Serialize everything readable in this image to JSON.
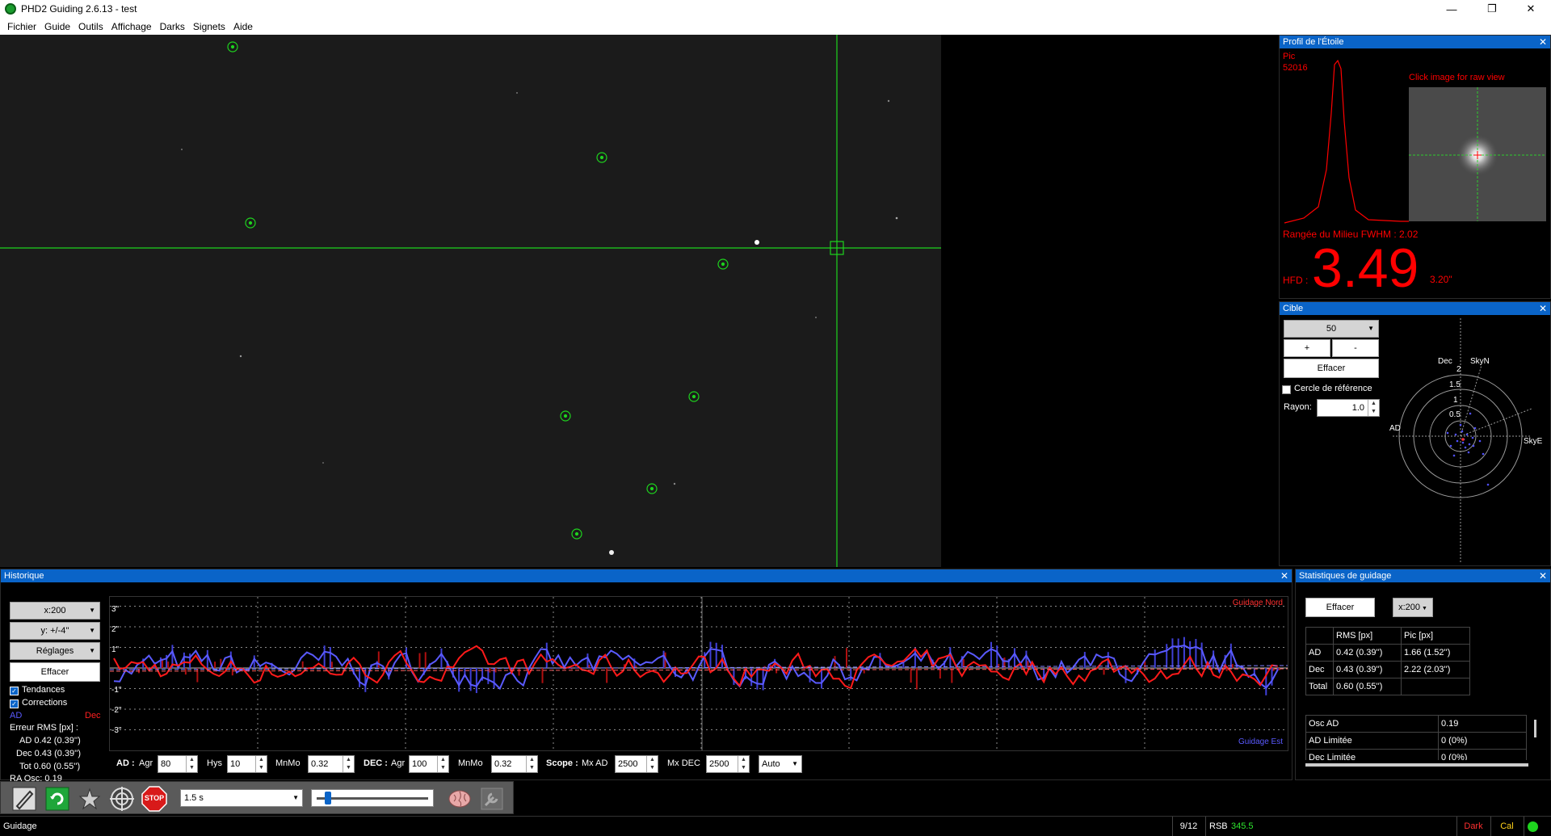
{
  "window": {
    "title": "PHD2 Guiding 2.6.13 - test",
    "minimize": "—",
    "maximize": "❐",
    "close": "✕"
  },
  "menu": [
    "Fichier",
    "Guide",
    "Outils",
    "Affichage",
    "Darks",
    "Signets",
    "Aide"
  ],
  "profile": {
    "title": "Profil de l'Étoile",
    "peak_label": "Pic",
    "peak_value": "52016",
    "click_hint": "Click image for raw view",
    "fwhm_label": "Rangée du Milieu FWHM : 2.02",
    "hfd_label": "HFD :",
    "hfd_value": "3.49",
    "hfd_arcsec": "3.20\""
  },
  "target": {
    "title": "Cible",
    "zoom": "50",
    "plus": "+",
    "minus": "-",
    "clear": "Effacer",
    "ref_circle": "Cercle de référence",
    "radius_label": "Rayon:",
    "radius_value": "1.0",
    "dec_label": "Dec",
    "skyn_label": "SkyN",
    "ad_label": "AD",
    "skye_label": "SkyE",
    "rings": [
      "2",
      "1.5",
      "1",
      "0.5"
    ]
  },
  "history": {
    "title": "Historique",
    "x_scale": "x:200",
    "y_scale": "y: +/-4''",
    "settings": "Réglages",
    "clear": "Effacer",
    "trends": "Tendances",
    "corrections": "Corrections",
    "ad_legend": "AD",
    "dec_legend": "Dec",
    "rms_title": "Erreur RMS [px] :",
    "rms_ad": "AD  0.42 (0.39'')",
    "rms_dec": "Dec  0.43 (0.39'')",
    "rms_tot": "Tot  0.60 (0.55'')",
    "ra_osc": "RA Osc: 0.19",
    "guide_north": "Guidage Nord",
    "guide_east": "Guidage Est",
    "y_ticks": [
      "3\"",
      "2\"",
      "1\"",
      "-1\"",
      "-2\"",
      "-3\""
    ],
    "ad_group": "AD :",
    "agr_label": "Agr",
    "ad_agr": "80",
    "hys_label": "Hys",
    "ad_hys": "10",
    "mnmo_label": "MnMo",
    "ad_mnmo": "0.32",
    "dec_group": "DEC :",
    "dec_agr": "100",
    "dec_mnmo": "0.32",
    "scope_group": "Scope :",
    "mx_ad_label": "Mx AD",
    "mx_ad": "2500",
    "mx_dec_label": "Mx DEC",
    "mx_dec": "2500",
    "dec_mode": "Auto"
  },
  "stats": {
    "title": "Statistiques de guidage",
    "clear": "Effacer",
    "x_scale": "x:200",
    "headers": [
      "",
      "RMS [px]",
      "Pic [px]"
    ],
    "rows": [
      [
        "AD",
        "0.42 (0.39'')",
        "1.66 (1.52'')"
      ],
      [
        "Dec",
        "0.43 (0.39'')",
        "2.22 (2.03'')"
      ],
      [
        "Total",
        "0.60 (0.55'')",
        ""
      ]
    ],
    "rows2": [
      [
        "Osc AD",
        "0.19"
      ],
      [
        "AD Limitée",
        "0 (0%)"
      ],
      [
        "Dec Limitée",
        "0 (0%)"
      ]
    ]
  },
  "toolbar": {
    "exposure": "1.5 s",
    "stop_label": "STOP"
  },
  "status": {
    "mode": "Guidage",
    "frames": "9/12",
    "snr_label": "RSB",
    "snr_value": "345.5",
    "dark": "Dark",
    "cal": "Cal"
  },
  "colors": {
    "ra": "#4b4bff",
    "dec": "#ff1a1a",
    "accent": "#0a64c8",
    "crosshair": "#1ed41e"
  }
}
